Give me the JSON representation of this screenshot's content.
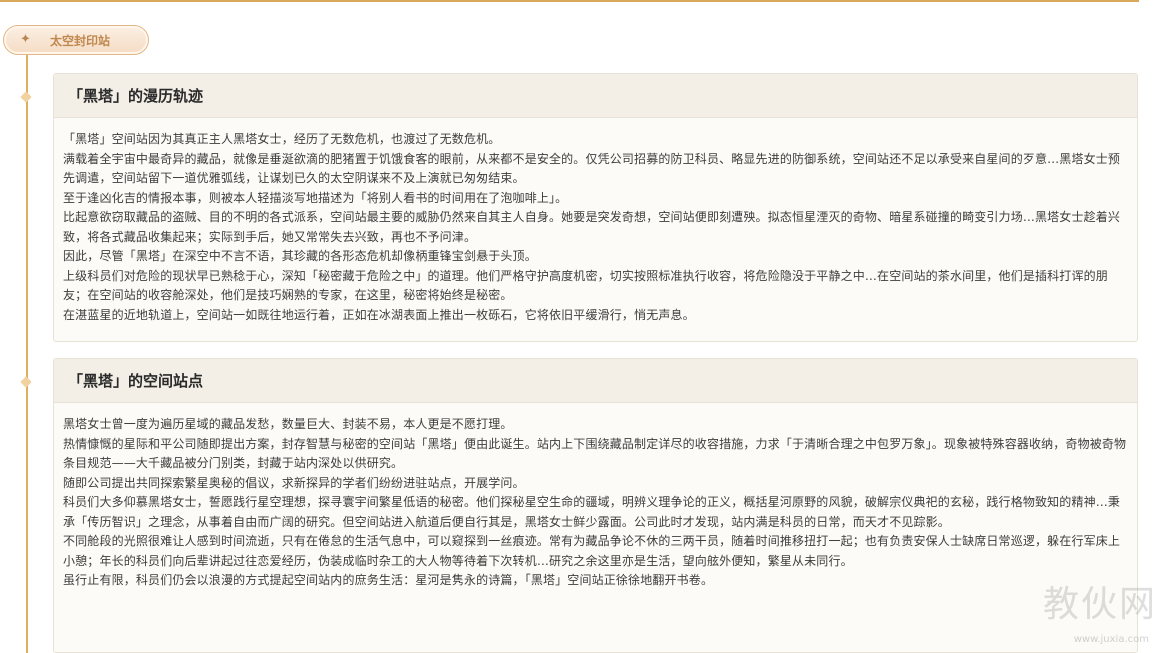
{
  "tag": {
    "icon": "sparkle-icon",
    "label": "太空封印站"
  },
  "sections": [
    {
      "title": "「黑塔」的漫历轨迹",
      "paragraphs": [
        "「黑塔」空间站因为其真正主人黑塔女士，经历了无数危机，也渡过了无数危机。",
        "满载着全宇宙中最奇异的藏品，就像是垂涎欲滴的肥猪置于饥饿食客的眼前，从来都不是安全的。仅凭公司招募的防卫科员、略显先进的防御系统，空间站还不足以承受来自星间的歹意…黑塔女士预先调遣，空间站留下一道优雅弧线，让谋划已久的太空阴谋来不及上演就已匆匆结束。",
        "至于逢凶化吉的情报本事，则被本人轻描淡写地描述为「将别人看书的时间用在了泡咖啡上」。",
        "比起意欲窃取藏品的盗贼、目的不明的各式派系，空间站最主要的威胁仍然来自其主人自身。她要是突发奇想，空间站便即刻遭殃。拟态恒星湮灭的奇物、暗星系碰撞的畸变引力场…黑塔女士趁着兴致，将各式藏品收集起来；实际到手后，她又常常失去兴致，再也不予问津。",
        "因此，尽管「黑塔」在深空中不言不语，其珍藏的各形态危机却像柄重锋宝剑悬于头顶。",
        "上级科员们对危险的现状早已熟稔于心，深知「秘密藏于危险之中」的道理。他们严格守护高度机密，切实按照标准执行收容，将危险隐没于平静之中…在空间站的茶水间里，他们是插科打诨的朋友；在空间站的收容舱深处，他们是技巧娴熟的专家，在这里，秘密将始终是秘密。",
        "在湛蓝星的近地轨道上，空间站一如既往地运行着，正如在冰湖表面上推出一枚砾石，它将依旧平缓滑行，悄无声息。"
      ]
    },
    {
      "title": "「黑塔」的空间站点",
      "paragraphs": [
        "黑塔女士曾一度为遍历星域的藏品发愁，数量巨大、封装不易，本人更是不愿打理。",
        "热情慷慨的星际和平公司随即提出方案，封存智慧与秘密的空间站「黑塔」便由此诞生。站内上下围绕藏品制定详尽的收容措施，力求「于清晰合理之中包罗万象」。现象被特殊容器收纳，奇物被奇物条目规范——大千藏品被分门别类，封藏于站内深处以供研究。",
        "随即公司提出共同探索繁星奥秘的倡议，求新探异的学者们纷纷进驻站点，开展学问。",
        "科员们大多仰慕黑塔女士，誓愿践行星空理想，探寻寰宇间繁星低语的秘密。他们探秘星空生命的疆域，明辨义理争论的正义，概括星河原野的风貌，破解宗仪典祀的玄秘，践行格物致知的精神…秉承「传历智识」之理念，从事着自由而广阔的研究。但空间站进入航道后便自行其是，黑塔女士鲜少露面。公司此时才发现，站内满是科员的日常，而天才不见踪影。",
        "不同舱段的光照很难让人感到时间流逝，只有在倦怠的生活气息中，可以窥探到一丝痕迹。常有为藏品争论不休的三两干员，随着时间推移扭打一起；也有负责安保人士缺席日常巡逻，躲在行军床上小憩；年长的科员们向后辈讲起过往恋爱经历，伪装成临时杂工的大人物等待着下次转机…研究之余这里亦是生活，望向舷外便知，繁星从未同行。",
        "虽行止有限，科员们仍会以浪漫的方式提起空间站内的庶务生活：星河是隽永的诗篇，「黑塔」空间站正徐徐地翻开书卷。"
      ]
    }
  ],
  "watermark": {
    "main": "教伙网",
    "sub": "www.juxia.com"
  }
}
